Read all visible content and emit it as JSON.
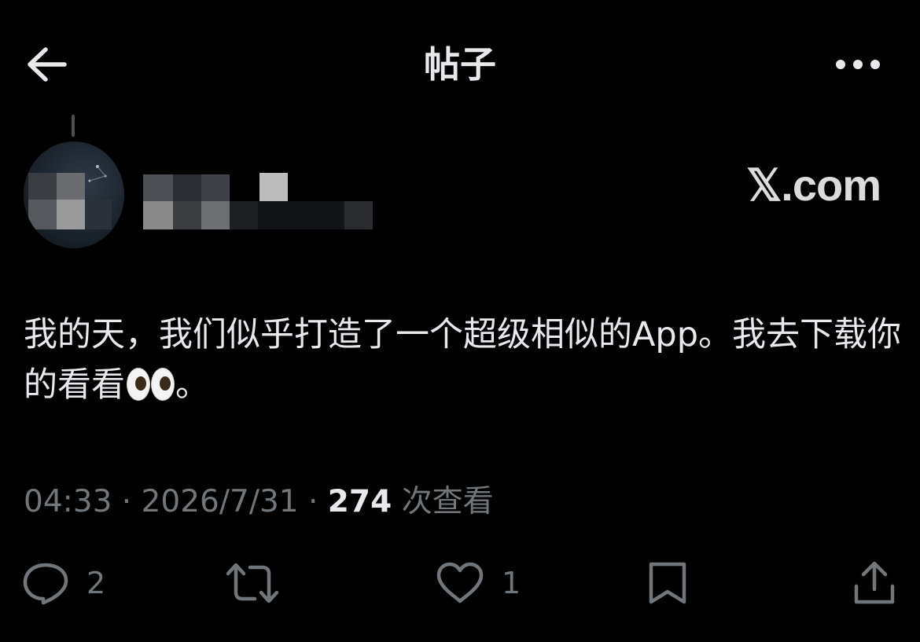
{
  "header": {
    "title": "帖子",
    "back_icon": "arrow-left-icon",
    "more_icon": "more-horizontal-icon"
  },
  "author": {
    "name_obscured": true,
    "watermark": "𝕏.com"
  },
  "post": {
    "text_part1": "我的天，我们似乎打造了一个超级相似的App。我去下载你的看看",
    "emoji": "eyes",
    "text_part2": "。"
  },
  "meta": {
    "time": "04:33",
    "separator": " · ",
    "date": "2026/7/31",
    "views_count": "274",
    "views_label": " 次查看"
  },
  "actions": {
    "reply_count": "2",
    "repost_count": "",
    "like_count": "1"
  },
  "colors": {
    "background": "#000000",
    "text_primary": "#e7e9ea",
    "text_secondary": "#71767b"
  }
}
